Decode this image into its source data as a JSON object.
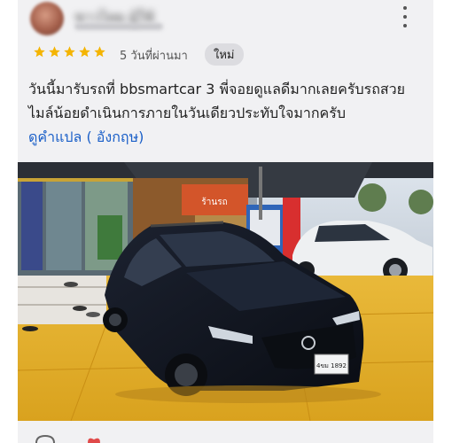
{
  "review": {
    "reviewer_name": "ชาวไทย ผู้ใช้",
    "rating": 5,
    "rating_max": 5,
    "time_ago": "5 วันที่ผ่านมา",
    "badge": "ใหม่",
    "text": "วันนี้มารับรถที่ bbsmartcar 3 พี่จอยดูแลดีมากเลยครับรถสวยไมล์น้อยดำเนินการภายในวันเดียวประทับใจมากครับ",
    "translate_label": "ดูคำแปล ( อังกฤษ)",
    "photo": {
      "shop_sign": "ร้านรถ",
      "license_plate": "4ขม 1892"
    }
  },
  "icons": {
    "more": "more-vert-icon",
    "star": "star-icon",
    "like": "heart-icon",
    "comment": "comment-icon"
  },
  "colors": {
    "star": "#f4b400",
    "link": "#1a5fc8",
    "card_bg": "#f1f1f3"
  }
}
